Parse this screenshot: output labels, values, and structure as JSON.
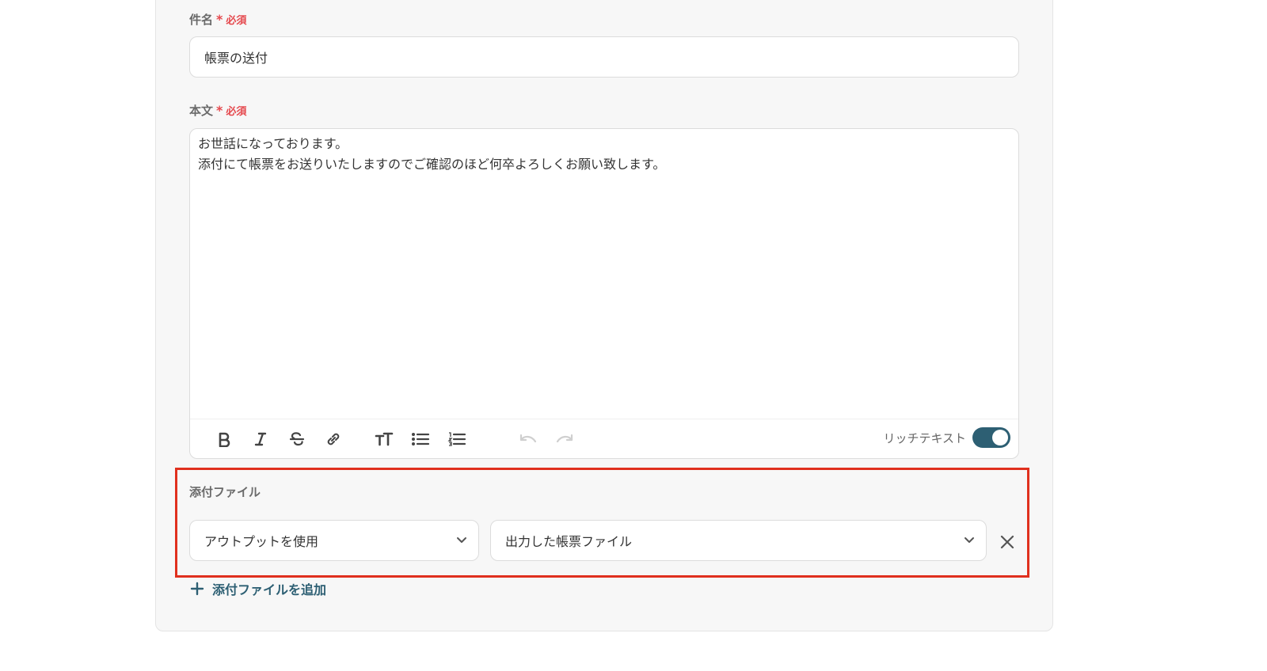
{
  "subject": {
    "label": "件名",
    "required_star": "*",
    "required_text": "必須",
    "value": "帳票の送付"
  },
  "body": {
    "label": "本文",
    "required_star": "*",
    "required_text": "必須",
    "lines": [
      "お世話になっております。",
      "添付にて帳票をお送りいたしますのでご確認のほど何卒よろしくお願い致します。"
    ],
    "toolbar": {
      "icons": [
        "bold-icon",
        "italic-icon",
        "strikethrough-icon",
        "link-icon",
        "text-size-icon",
        "bullet-list-icon",
        "numbered-list-icon",
        "undo-icon",
        "redo-icon"
      ],
      "rich_text_label": "リッチテキスト",
      "rich_text_enabled": true
    }
  },
  "attachments": {
    "label": "添付ファイル",
    "source_select": "アウトプットを使用",
    "file_select": "出力した帳票ファイル",
    "add_label": "添付ファイルを追加"
  },
  "colors": {
    "accent": "#2d5f73",
    "required": "#e5484d",
    "highlight": "#e0301e"
  }
}
